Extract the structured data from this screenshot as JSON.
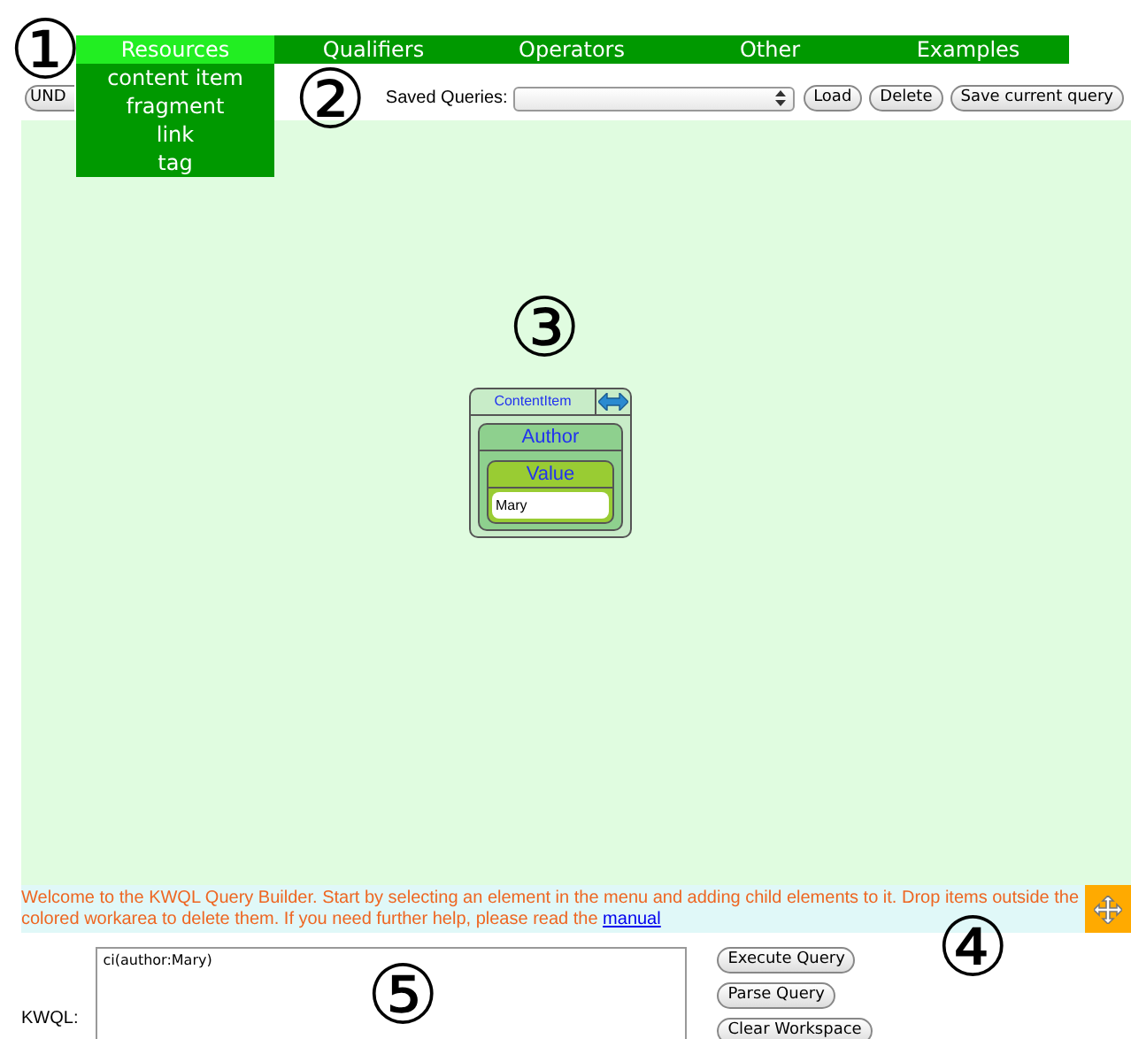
{
  "menu": [
    {
      "label": "Resources",
      "selected": true,
      "items": [
        "content item",
        "fragment",
        "link",
        "tag"
      ]
    },
    {
      "label": "Qualifiers",
      "selected": false
    },
    {
      "label": "Operators",
      "selected": false
    },
    {
      "label": "Other",
      "selected": false
    },
    {
      "label": "Examples",
      "selected": false
    }
  ],
  "undo_button": "UND",
  "saved_queries": {
    "label": "Saved Queries:"
  },
  "query_buttons": [
    "Load",
    "Delete",
    "Save current query"
  ],
  "query_node": {
    "label": "ContentItem",
    "child": {
      "label": "Author",
      "child": {
        "label": "Value",
        "value": "Mary"
      }
    }
  },
  "message": {
    "text": "Welcome to the KWQL Query Builder. Start by selecting an element in the menu and adding child elements to it. Drop items outside the colored workarea to delete them. If you need further help, please read the",
    "link": "manual"
  },
  "kwql": {
    "label": "KWQL:",
    "value": "ci(author:Mary)"
  },
  "actions": [
    "Execute Query",
    "Parse Query",
    "Clear Workspace"
  ],
  "callouts": [
    "①",
    "②",
    "③",
    "④",
    "⑤"
  ]
}
